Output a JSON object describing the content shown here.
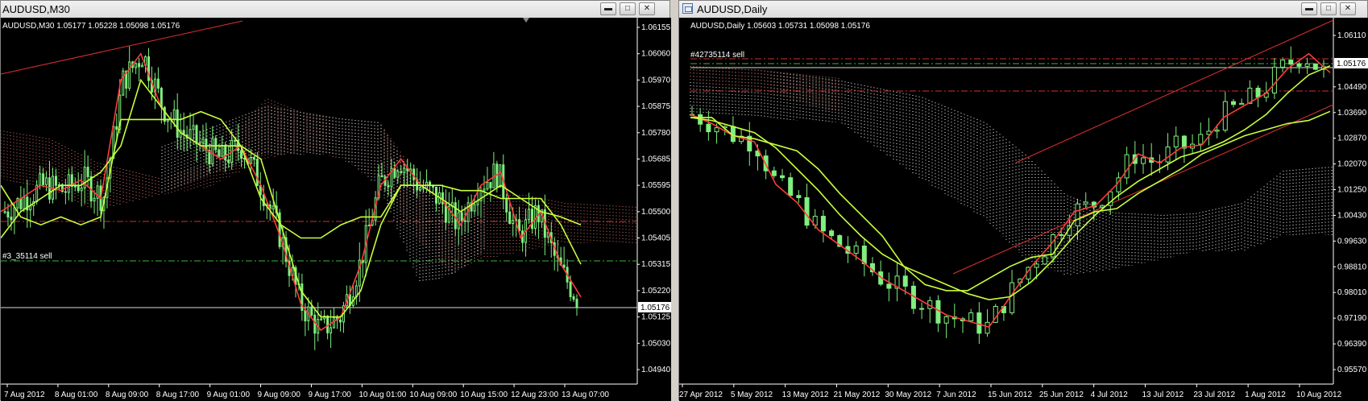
{
  "left": {
    "window_title": "AUDUSD,M30",
    "info": "AUDUSD,M30  1.05177 1.05228 1.05098 1.05176",
    "order_label": "#3_35114 sell",
    "current_price": "1.05176",
    "y_labels": [
      "1.06155",
      "1.06060",
      "1.05970",
      "1.05875",
      "1.05780",
      "1.05685",
      "1.05595",
      "1.05500",
      "1.05405",
      "1.05315",
      "1.05220",
      "1.05125",
      "1.05030",
      "1.04940"
    ],
    "x_labels": [
      "7 Aug 2012",
      "8 Aug 01:00",
      "8 Aug 09:00",
      "8 Aug 17:00",
      "9 Aug 01:00",
      "9 Aug 09:00",
      "9 Aug 17:00",
      "10 Aug 01:00",
      "10 Aug 09:00",
      "10 Aug 15:00",
      "12 Aug 23:00",
      "13 Aug 07:00"
    ]
  },
  "right": {
    "window_title": "AUDUSD,Daily",
    "info": "AUDUSD,Daily  1.05603 1.05731 1.05098 1.05176",
    "order_label": "#42735114 sell",
    "current_price": "1.05176",
    "y_labels": [
      "1.06110",
      "1.05176",
      "1.04490",
      "1.03690",
      "1.02870",
      "1.02070",
      "1.01250",
      "1.00430",
      "0.99630",
      "0.98810",
      "0.98010",
      "0.97190",
      "0.96390",
      "0.95570"
    ],
    "x_labels": [
      "27 Apr 2012",
      "5 May 2012",
      "13 May 2012",
      "21 May 2012",
      "30 May 2012",
      "7 Jun 2012",
      "15 Jun 2012",
      "25 Jun 2012",
      "4 Jul 2012",
      "13 Jul 2012",
      "23 Jul 2012",
      "1 Aug 2012",
      "10 Aug 2012"
    ]
  },
  "chart_data": [
    {
      "type": "line",
      "title": "AUDUSD,M30",
      "ylim": [
        1.049,
        1.062
      ],
      "series": [
        {
          "values": [
            1.055,
            1.0555,
            1.056,
            1.0558,
            1.0562,
            1.0555,
            1.06,
            1.061,
            1.059,
            1.058,
            1.0575,
            1.057,
            1.0575,
            1.056,
            1.054,
            1.0515,
            1.0505,
            1.051,
            1.053,
            1.056,
            1.057,
            1.056,
            1.0555,
            1.0545,
            1.056,
            1.0565,
            1.054,
            1.055,
            1.053,
            1.05176
          ]
        },
        {
          "values": [
            1.054,
            1.055,
            1.0555,
            1.056,
            1.056,
            1.0565,
            1.0575,
            1.06,
            1.059,
            1.058,
            1.0575,
            1.0575,
            1.0575,
            1.057,
            1.0545,
            1.052,
            1.051,
            1.051,
            1.052,
            1.0545,
            1.056,
            1.056,
            1.0555,
            1.055,
            1.0555,
            1.056,
            1.0555,
            1.0555,
            1.0545,
            1.053
          ]
        },
        {
          "values": [
            1.056,
            1.0548,
            1.0545,
            1.0548,
            1.0545,
            1.0548,
            1.0585,
            1.0585,
            1.0585,
            1.0585,
            1.0588,
            1.0585,
            1.0575,
            1.0555,
            1.0545,
            1.054,
            1.054,
            1.0545,
            1.0548,
            1.0548,
            1.056,
            1.056,
            1.056,
            1.0558,
            1.0558,
            1.0555,
            1.0555,
            1.055,
            1.0548,
            1.0545
          ]
        }
      ]
    },
    {
      "type": "line",
      "title": "AUDUSD,Daily",
      "ylim": [
        0.954,
        1.064
      ],
      "series": [
        {
          "values": [
            1.038,
            1.035,
            1.031,
            1.029,
            1.015,
            1.009,
            1.0,
            0.995,
            0.99,
            0.984,
            0.98,
            0.976,
            0.972,
            0.97,
            0.968,
            0.978,
            0.988,
            0.996,
            1.006,
            1.008,
            1.015,
            1.025,
            1.022,
            1.027,
            1.028,
            1.037,
            1.041,
            1.045,
            1.053,
            1.058,
            1.05176
          ]
        },
        {
          "values": [
            1.037,
            1.036,
            1.034,
            1.032,
            1.027,
            1.02,
            1.013,
            1.005,
            0.998,
            0.992,
            0.988,
            0.985,
            0.982,
            0.979,
            0.977,
            0.978,
            0.983,
            0.99,
            0.998,
            1.005,
            1.011,
            1.016,
            1.02,
            1.024,
            1.026,
            1.029,
            1.033,
            1.038,
            1.045,
            1.051,
            1.054
          ]
        },
        {
          "values": [
            1.037,
            1.037,
            1.031,
            1.03,
            1.028,
            1.026,
            1.02,
            1.012,
            1.005,
            0.998,
            0.988,
            0.982,
            0.98,
            0.98,
            0.984,
            0.988,
            0.991,
            0.992,
            1.003,
            1.006,
            1.007,
            1.012,
            1.016,
            1.02,
            1.025,
            1.028,
            1.031,
            1.033,
            1.035,
            1.036,
            1.039
          ]
        }
      ]
    }
  ],
  "colors": {
    "background": "#000000",
    "bull": "#7ff07f",
    "tenkan": "#ff3b3b",
    "kijun": "#c8ff3c",
    "cloud": "#ffffff",
    "cloud_red": "#d87a6a",
    "order_line": "#d03030",
    "price_line": "#dddddd",
    "green_dash": "#3cb43c",
    "trend": "#e03030",
    "axis": "#ffffff"
  }
}
